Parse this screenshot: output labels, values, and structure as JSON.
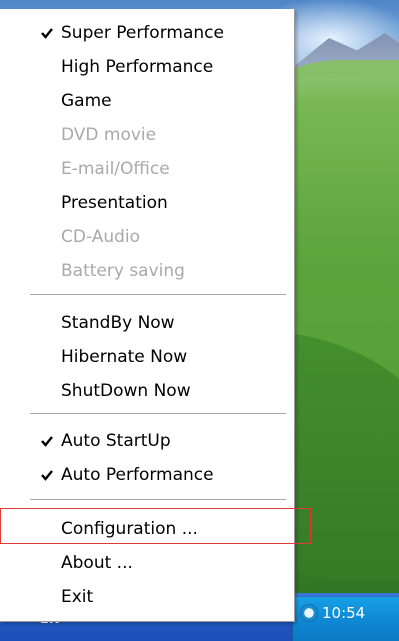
{
  "taskbar": {
    "language": "EN",
    "clock": "10:54"
  },
  "menu": {
    "items": [
      {
        "label": "Super Performance",
        "checked": true,
        "enabled": true
      },
      {
        "label": "High Performance",
        "checked": false,
        "enabled": true
      },
      {
        "label": "Game",
        "checked": false,
        "enabled": true
      },
      {
        "label": "DVD movie",
        "checked": false,
        "enabled": false
      },
      {
        "label": "E-mail/Office",
        "checked": false,
        "enabled": false
      },
      {
        "label": "Presentation",
        "checked": false,
        "enabled": true
      },
      {
        "label": "CD-Audio",
        "checked": false,
        "enabled": false
      },
      {
        "label": "Battery saving",
        "checked": false,
        "enabled": false
      },
      {
        "label": "StandBy Now",
        "checked": false,
        "enabled": true
      },
      {
        "label": "Hibernate Now",
        "checked": false,
        "enabled": true
      },
      {
        "label": "ShutDown Now",
        "checked": false,
        "enabled": true
      },
      {
        "label": "Auto StartUp",
        "checked": true,
        "enabled": true
      },
      {
        "label": "Auto Performance",
        "checked": true,
        "enabled": true
      },
      {
        "label": "Configuration ...",
        "checked": false,
        "enabled": true
      },
      {
        "label": "About ...",
        "checked": false,
        "enabled": true
      },
      {
        "label": "Exit",
        "checked": false,
        "enabled": true
      }
    ]
  },
  "colors": {
    "disabled_text": "#a9a9a9",
    "highlight_box": "#e23a3a"
  },
  "icons": [
    "checkmark-icon",
    "network-icon",
    "security-shield-icon",
    "volume-icon",
    "clock-icon"
  ]
}
